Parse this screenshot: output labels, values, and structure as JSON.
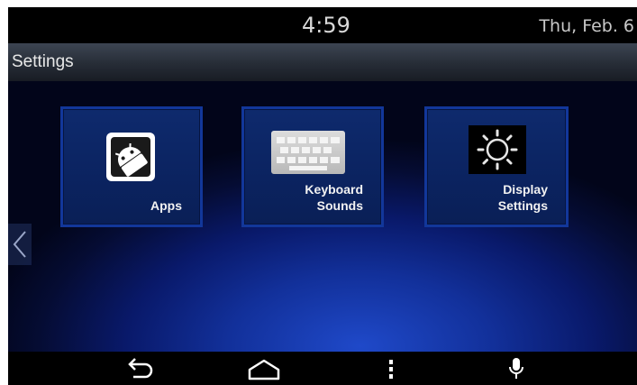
{
  "status_bar": {
    "time": "4:59",
    "date": "Thu, Feb. 6"
  },
  "header": {
    "title": "Settings"
  },
  "tiles": [
    {
      "label": "Apps",
      "icon": "android-apps-icon"
    },
    {
      "label": "Keyboard\nSounds",
      "icon": "keyboard-icon"
    },
    {
      "label": "Display\nSettings",
      "icon": "brightness-icon"
    }
  ],
  "navigation": {
    "left_arrow_icon": "chevron-left-icon",
    "buttons": [
      "back-icon",
      "home-icon",
      "menu-icon",
      "microphone-icon"
    ]
  },
  "colors": {
    "tile_border": "#12379a",
    "background_glow": "#1f49c9"
  }
}
